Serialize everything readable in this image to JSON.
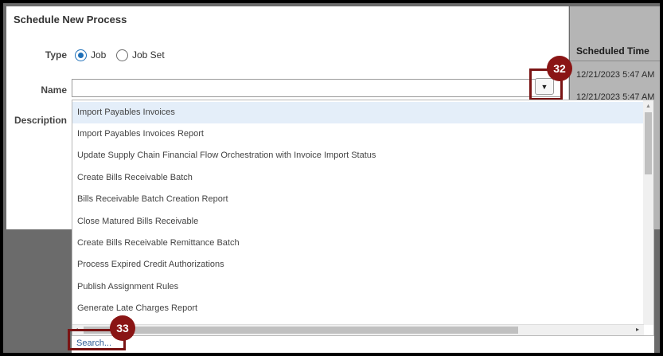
{
  "dialog": {
    "title": "Schedule New Process",
    "type_label": "Type",
    "type_options": [
      "Job",
      "Job Set"
    ],
    "type_selected": "Job",
    "name_label": "Name",
    "name_value": "",
    "description_label": "Description"
  },
  "background_table": {
    "header": "Scheduled Time",
    "rows": [
      "12/21/2023 5:47 AM",
      "12/21/2023 5:47 AM"
    ]
  },
  "dropdown": {
    "items": [
      "Import Payables Invoices",
      "Import Payables Invoices Report",
      "Update Supply Chain Financial Flow Orchestration with Invoice Import Status",
      "Create Bills Receivable Batch",
      "Bills Receivable Batch Creation Report",
      "Close Matured Bills Receivable",
      "Create Bills Receivable Remittance Batch",
      "Process Expired Credit Authorizations",
      "Publish Assignment Rules",
      "Generate Late Charges Report"
    ],
    "highlighted_index": 0,
    "search_link": "Search..."
  },
  "callouts": {
    "dropdown_button": "32",
    "search_link": "33"
  },
  "colors": {
    "accent": "#1e6fb8",
    "callout": "#8a1515",
    "highlight": "#e4eef9"
  }
}
